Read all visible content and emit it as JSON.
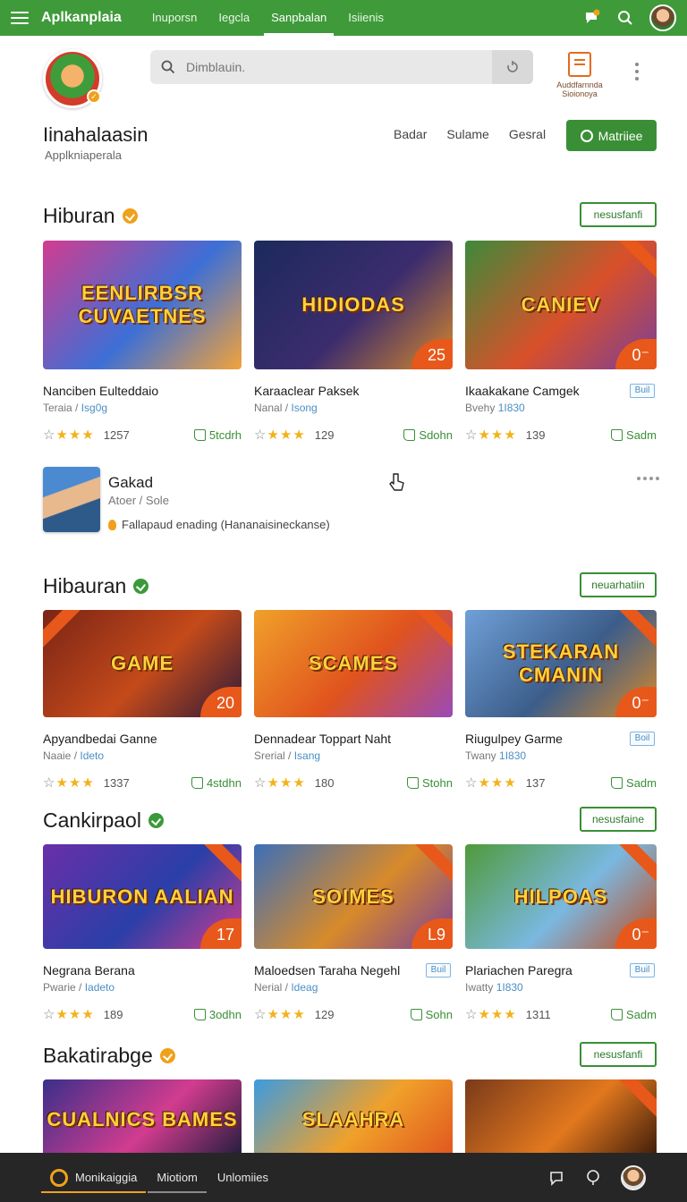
{
  "topbar": {
    "brand": "Aplkanplaia",
    "tabs": [
      "Inuporsn",
      "Iegcla",
      "Sanpbalan",
      "Isiienis"
    ],
    "active_tab": "Sanpbalan"
  },
  "search": {
    "placeholder": "Dimblauin."
  },
  "promo": {
    "label": "Auddfarnnda Sioionoya"
  },
  "app": {
    "name": "Iinahalaasin",
    "subtitle": "Applkniaperala",
    "links": [
      "Badar",
      "Sulame",
      "Gesral"
    ],
    "primary_button": "Matriiee"
  },
  "featured": {
    "title": "Gakad",
    "subtitle": "Atoer / Sole",
    "description": "Fallapaud enading  (Hananaisineckanse)"
  },
  "sections": [
    {
      "title": "Hiburan",
      "badge_color": "#f0a11a",
      "button": "nesusfanfi",
      "cards": [
        {
          "thumb_text": "EENLIRBSR CUVAETNES",
          "corner": "",
          "title": "Nanciben Eulteddaio",
          "sub": "Teraia / ",
          "sub_hl": "Isg0g",
          "rating_count": "1257",
          "action": "5tcdrh",
          "tag": "",
          "colors": [
            "#d23c8f",
            "#3d6fd6",
            "#f2a33a"
          ]
        },
        {
          "thumb_text": "HIDIODAS",
          "corner": "25",
          "title": "Karaaclear Paksek",
          "sub": "Nanal / ",
          "sub_hl": "Isong",
          "rating_count": "129",
          "action": "Sdohn",
          "tag": "",
          "colors": [
            "#1b2a5c",
            "#3c2c6e",
            "#d88a2a"
          ]
        },
        {
          "thumb_text": "CANIEV",
          "corner": "0⁻",
          "title": "Ikaakakane Camgek",
          "sub": "Bvehy ",
          "sub_hl": "1I830",
          "rating_count": "139",
          "action": "Sadm",
          "tag": "Buil",
          "colors": [
            "#3d8a3a",
            "#d9502a",
            "#7a3f9a"
          ]
        }
      ]
    },
    {
      "title": "Hibauran",
      "badge_color": "#3a9a3a",
      "button": "neuarhatiin",
      "cards": [
        {
          "thumb_text": "GAME",
          "corner": "20",
          "title": "Apyandbedai Ganne",
          "sub": "Naaie / ",
          "sub_hl": "Ideto",
          "rating_count": "1337",
          "action": "4stdhn",
          "tag": "",
          "colors": [
            "#7a2416",
            "#c44a1a",
            "#2c1a3a"
          ]
        },
        {
          "thumb_text": "SCAMES",
          "corner": "",
          "title": "Dennadear Toppart Naht",
          "sub": "Srerial / ",
          "sub_hl": "Isang",
          "rating_count": "180",
          "action": "Stohn",
          "tag": "",
          "colors": [
            "#f0a12a",
            "#e0531e",
            "#9a4ab8"
          ]
        },
        {
          "thumb_text": "STEKARAN CMANIN",
          "corner": "0⁻",
          "title": "Riugulpey Garme",
          "sub": "Twany ",
          "sub_hl": "1I830",
          "rating_count": "137",
          "action": "Sadm",
          "tag": "Boil",
          "colors": [
            "#6fa0d8",
            "#3c5d8a",
            "#d88a2a"
          ]
        }
      ]
    },
    {
      "title": "Cankirpaol",
      "badge_color": "#3a9a3a",
      "button": "nesusfaine",
      "cards": [
        {
          "thumb_text": "HIBURON AALIAN",
          "corner": "17",
          "title": "Negrana Berana",
          "sub": "Pwarie / ",
          "sub_hl": "Iadeto",
          "rating_count": "189",
          "action": "3odhn",
          "tag": "",
          "colors": [
            "#6a2fa8",
            "#2a3fa8",
            "#d23c8f"
          ]
        },
        {
          "thumb_text": "SOIMES",
          "corner": "L9",
          "title": "Maloedsen Taraha Negehl",
          "sub": "Nerial / ",
          "sub_hl": "Ideag",
          "rating_count": "129",
          "action": "Sohn",
          "tag": "Buil",
          "colors": [
            "#3c6fb8",
            "#d88a2a",
            "#7a3f9a"
          ]
        },
        {
          "thumb_text": "HILPOAS",
          "corner": "0⁻",
          "title": "Plariachen Paregra",
          "sub": "Iwatty ",
          "sub_hl": "1I830",
          "rating_count": "1311",
          "action": "Sadm",
          "tag": "Buil",
          "colors": [
            "#4f9a3a",
            "#7ab8e0",
            "#c24a1a"
          ]
        }
      ]
    },
    {
      "title": "Bakatirabge",
      "badge_color": "#f0a11a",
      "button": "nesusfanfi",
      "cards": [
        {
          "thumb_text": "CUALNICS BAMES",
          "corner": "",
          "colors": [
            "#3a2f8a",
            "#d23c8f",
            "#1c1c3a"
          ]
        },
        {
          "thumb_text": "SLAAHRA",
          "corner": "",
          "colors": [
            "#3b9be0",
            "#f0a12a",
            "#e0531e"
          ]
        },
        {
          "thumb_text": "",
          "corner": "",
          "colors": [
            "#7a3a1a",
            "#e2781e",
            "#3a1a0a"
          ]
        }
      ]
    }
  ],
  "bottombar": {
    "tabs": [
      "Monikaiggia",
      "Miotiom",
      "Unlomiies"
    ]
  }
}
